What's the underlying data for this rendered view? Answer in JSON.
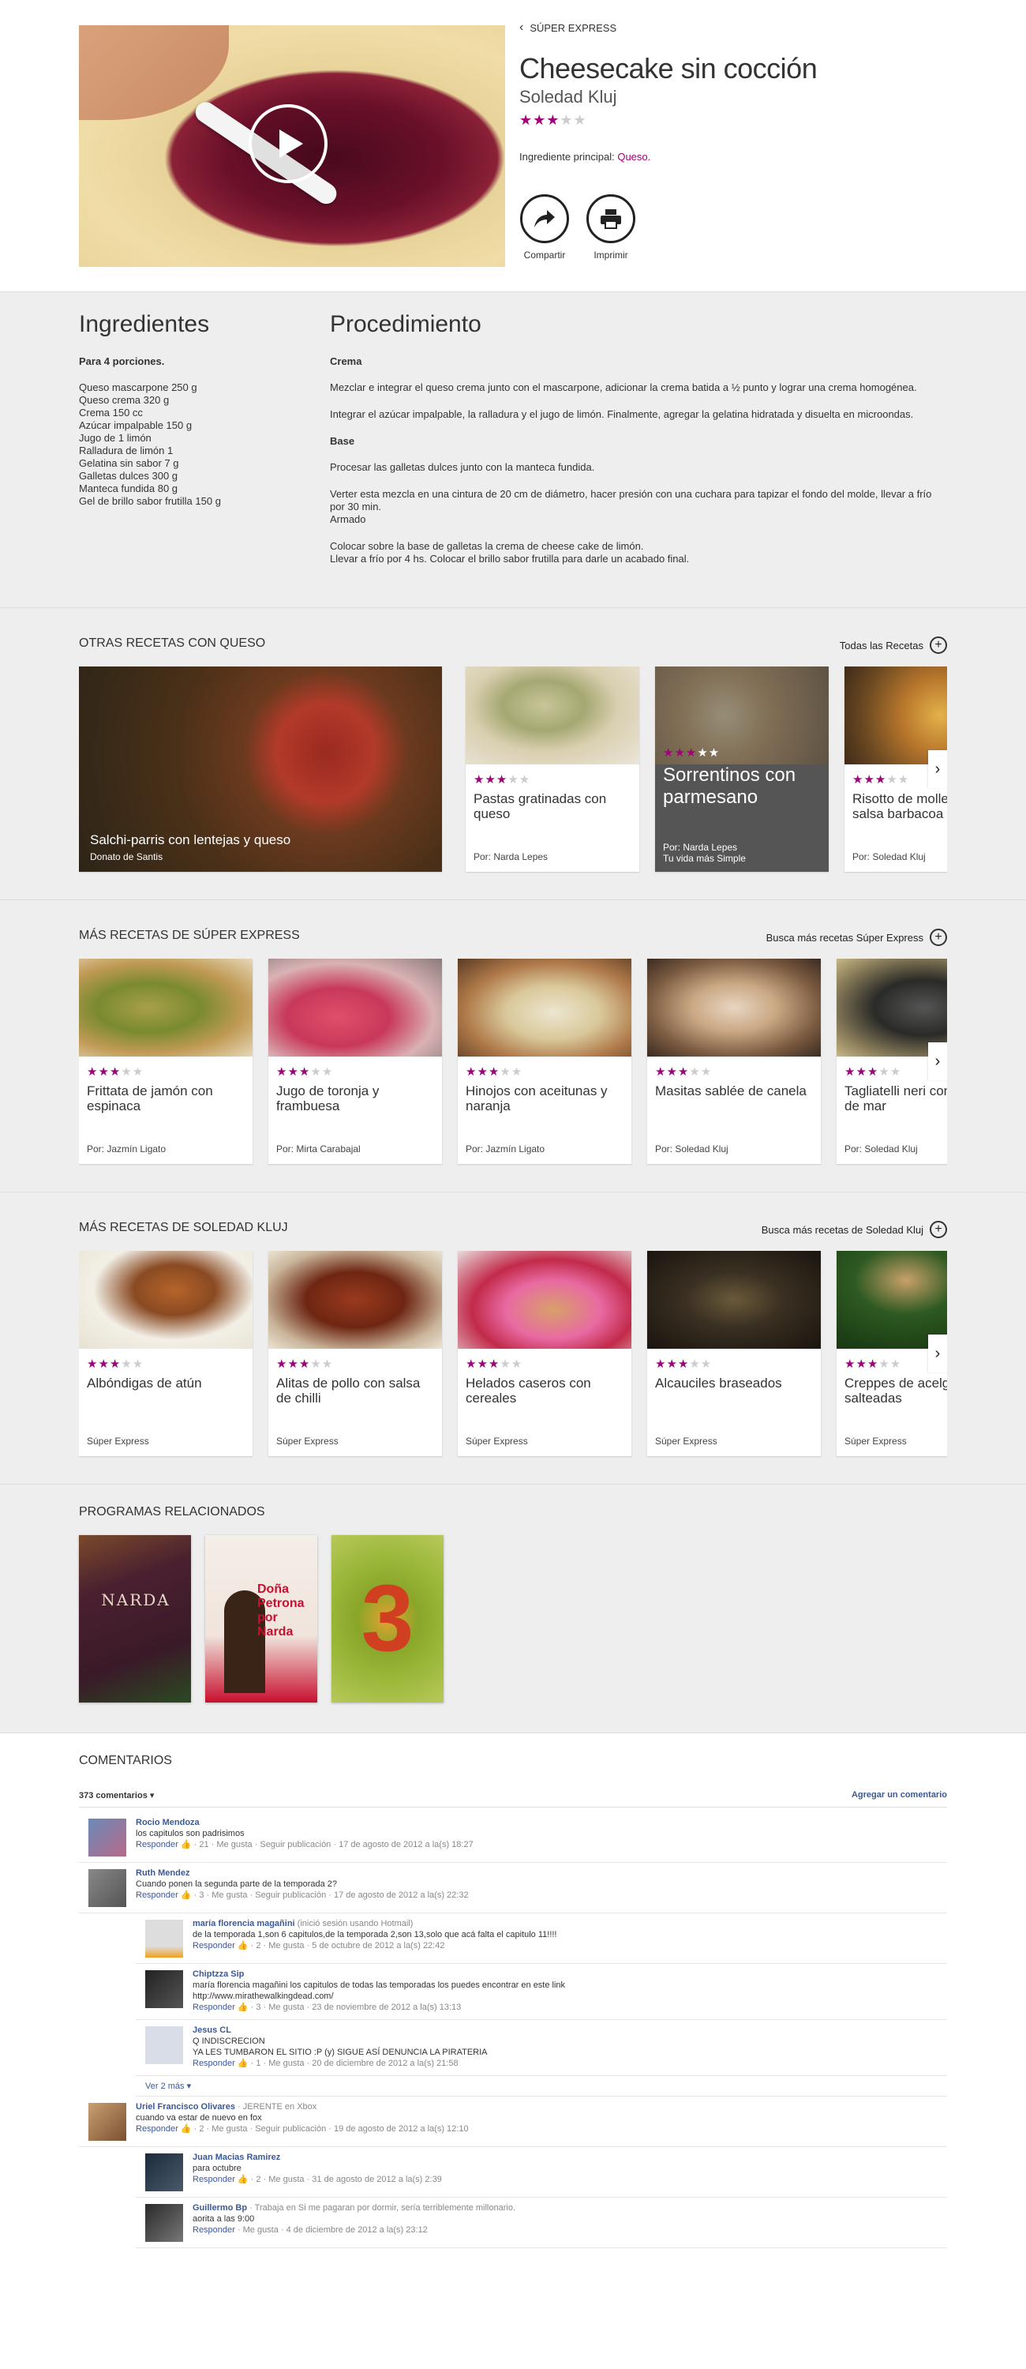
{
  "hero": {
    "back_label": "SÚPER EXPRESS",
    "title": "Cheesecake sin cocción",
    "author": "Soledad Kluj",
    "rating_stars": "★★★",
    "rating_off": "★★",
    "main_ingredient_label": "Ingrediente principal:",
    "main_ingredient_value": "Queso.",
    "share_label": "Compartir",
    "print_label": "Imprimir"
  },
  "ingredients": {
    "title": "Ingredientes",
    "portions": "Para 4 porciones.",
    "items": [
      "Queso mascarpone 250 g",
      "Queso crema 320 g",
      "Crema 150 cc",
      "Azúcar impalpable 150 g",
      "Jugo de 1 limón",
      "Ralladura de limón 1",
      "Gelatina sin sabor 7 g",
      "Galletas dulces 300 g",
      "Manteca fundida 80 g",
      "Gel de brillo sabor frutilla 150 g"
    ]
  },
  "procedure": {
    "title": "Procedimiento",
    "sub1": "Crema",
    "p1": "Mezclar e integrar el queso crema junto con el mascarpone, adicionar la crema batida a ½ punto y lograr una crema homogénea.",
    "p2": "Integrar el azúcar impalpable, la ralladura y el jugo de limón. Finalmente, agregar la gelatina hidratada y disuelta en microondas.",
    "sub2": "Base",
    "p3": "Procesar las galletas dulces junto con la manteca fundida.",
    "p4": "Verter esta mezcla en una cintura de 20 cm de diámetro, hacer presión con una cuchara para tapizar el fondo del molde, llevar a frío por 30 min.\nArmado",
    "p5": "Colocar sobre la base de galletas la crema de cheese cake de limón.\nLlevar a frío por 4 hs. Colocar el brillo sabor frutilla para darle un acabado final."
  },
  "carousel1": {
    "title": "OTRAS RECETAS CON QUESO",
    "link": "Todas las Recetas",
    "big": {
      "name": "Salchi-parris con lentejas y queso",
      "author": "Donato de Santis"
    },
    "cards": [
      {
        "name": "Pastas gratinadas con queso",
        "by": "Por: Narda Lepes"
      },
      {
        "name": "Sorrentinos con parmesano",
        "by": "Por: Narda Lepes",
        "by2": "Tu vida más Simple"
      },
      {
        "name": "Risotto de mollejas con salsa barbacoa",
        "by": "Por: Soledad Kluj"
      }
    ]
  },
  "carousel2": {
    "title": "MÁS RECETAS DE SÚPER EXPRESS",
    "link": "Busca más recetas Súper Express",
    "cards": [
      {
        "name": "Frittata de jamón con espinaca",
        "by": "Por: Jazmín Ligato"
      },
      {
        "name": "Jugo de toronja y frambuesa",
        "by": "Por: Mirta Carabajal"
      },
      {
        "name": "Hinojos con aceitunas y naranja",
        "by": "Por: Jazmín Ligato"
      },
      {
        "name": "Masitas sablée de canela",
        "by": "Por: Soledad Kluj"
      },
      {
        "name": "Tagliatelli neri con salsa de mar",
        "by": "Por: Soledad Kluj"
      }
    ]
  },
  "carousel3": {
    "title": "MÁS RECETAS DE SOLEDAD KLUJ",
    "link": "Busca más recetas de Soledad Kluj",
    "cards": [
      {
        "name": "Albóndigas de atún",
        "by": "Súper Express"
      },
      {
        "name": "Alitas de pollo con salsa de chilli",
        "by": "Súper Express"
      },
      {
        "name": "Helados caseros con cereales",
        "by": "Súper Express"
      },
      {
        "name": "Alcauciles braseados",
        "by": "Súper Express"
      },
      {
        "name": "Creppes de acelga salteadas",
        "by": "Súper Express"
      }
    ]
  },
  "programs": {
    "title": "PROGRAMAS RELACIONADOS",
    "items": [
      {
        "label": "NARDA"
      },
      {
        "label": "Doña Petrona por Narda"
      },
      {
        "label": "3"
      }
    ]
  },
  "comments": {
    "title": "COMENTARIOS",
    "count": "373 comentarios ▾",
    "add": "Agregar un comentario",
    "more": "Ver 2 más ▾",
    "list": [
      {
        "name": "Rocio Mendoza",
        "meta": "",
        "msg": "los capitulos son padrisimos",
        "act": "· 21 · Me gusta · Seguir publicación · 17 de agosto de 2012 a la(s) 18:27",
        "reply": false
      },
      {
        "name": "Ruth Mendez",
        "meta": "",
        "msg": "Cuando ponen la segunda parte de la temporada 2?",
        "act": "· 3 · Me gusta · Seguir publicación · 17 de agosto de 2012 a la(s) 22:32",
        "reply": false
      },
      {
        "name": "maría florencia magañini",
        "meta": "(inició sesión usando Hotmail)",
        "msg": "de la temporada 1,son 6 capitulos,de la temporada 2,son 13,solo que acá falta el capitulo 11!!!!",
        "act": "· 2 · Me gusta · 5 de octubre de 2012 a la(s) 22:42",
        "reply": true
      },
      {
        "name": "Chiptzza Sip",
        "meta": "",
        "msg": "maría florencia magañini los capitulos de todas las temporadas los puedes encontrar en este link\nhttp://www.mirathewalkingdead.com/",
        "act": "· 3 · Me gusta · 23 de noviembre de 2012 a la(s) 13:13",
        "reply": true
      },
      {
        "name": "Jesus CL",
        "meta": "",
        "msg": "Q INDISCRECION\nYA LES TUMBARON EL SITIO :P (y) SIGUE ASÍ DENUNCIA LA PIRATERIA",
        "act": "· 1 · Me gusta · 20 de diciembre de 2012 a la(s) 21:58",
        "reply": true
      },
      {
        "name": "Uriel Francisco Olivares",
        "meta": "· JERENTE en Xbox",
        "msg": "cuando va estar de nuevo en fox",
        "act": "· 2 · Me gusta · Seguir publicación · 19 de agosto de 2012 a la(s) 12:10",
        "reply": false
      },
      {
        "name": "Juan Macias Ramirez",
        "meta": "",
        "msg": "para octubre",
        "act": "· 2 · Me gusta · 31 de agosto de 2012 a la(s) 2:39",
        "reply": true
      },
      {
        "name": "Guillermo Bp",
        "meta": "· Trabaja en Si me pagaran por dormir, sería terriblemente millonario.",
        "msg": "aorita a las 9:00",
        "act": "· Me gusta · 4 de diciembre de 2012 a la(s) 23:12",
        "reply": true
      }
    ],
    "reply_label": "Responder"
  }
}
